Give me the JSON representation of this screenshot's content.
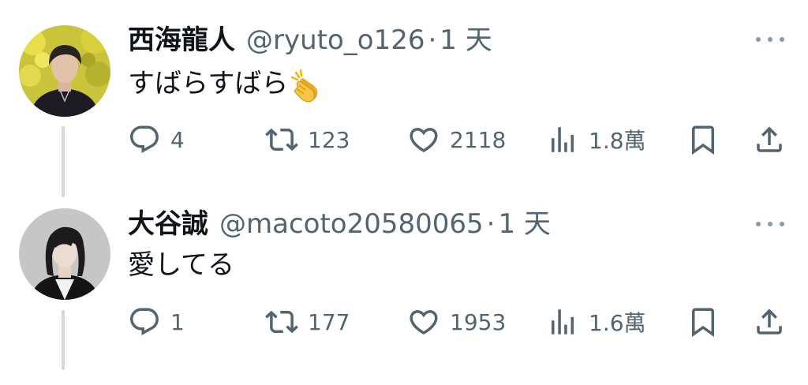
{
  "tweets": [
    {
      "display_name": "西海龍人",
      "handle": "@ryuto_o126",
      "separator": "·",
      "time": "1 天",
      "text": "すばらすばら",
      "emoji": "clapping-hands",
      "avatar": "avatar-photo-yellow-flowers",
      "stats": {
        "replies": "4",
        "retweets": "123",
        "likes": "2118",
        "views": "1.8萬"
      }
    },
    {
      "display_name": "大谷誠",
      "handle": "@macoto20580065",
      "separator": "·",
      "time": "1 天",
      "text": "愛してる",
      "avatar": "avatar-photo-gray-background",
      "stats": {
        "replies": "1",
        "retweets": "177",
        "likes": "1953",
        "views": "1.6萬"
      }
    }
  ],
  "colors": {
    "text_primary": "#0f1419",
    "text_secondary": "#536471",
    "thread_line": "#cfd9de",
    "background": "#ffffff"
  },
  "icons": {
    "reply": "reply-icon",
    "retweet": "retweet-icon",
    "like": "like-icon",
    "views": "views-icon",
    "bookmark": "bookmark-icon",
    "share": "share-icon",
    "more": "more-icon"
  }
}
